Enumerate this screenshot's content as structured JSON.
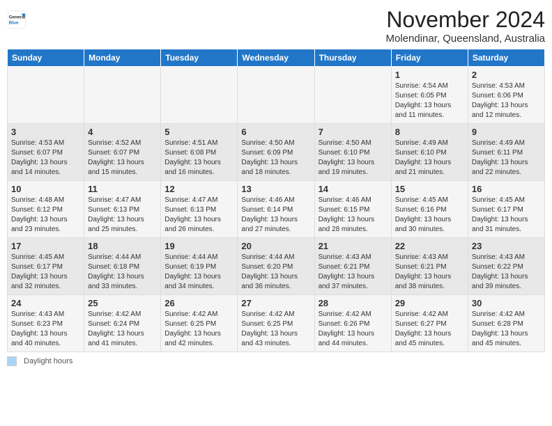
{
  "header": {
    "title": "November 2024",
    "subtitle": "Molendinar, Queensland, Australia"
  },
  "logo": {
    "line1": "General",
    "line2": "Blue"
  },
  "days_of_week": [
    "Sunday",
    "Monday",
    "Tuesday",
    "Wednesday",
    "Thursday",
    "Friday",
    "Saturday"
  ],
  "weeks": [
    [
      {
        "day": "",
        "info": ""
      },
      {
        "day": "",
        "info": ""
      },
      {
        "day": "",
        "info": ""
      },
      {
        "day": "",
        "info": ""
      },
      {
        "day": "",
        "info": ""
      },
      {
        "day": "1",
        "info": "Sunrise: 4:54 AM\nSunset: 6:05 PM\nDaylight: 13 hours and 11 minutes."
      },
      {
        "day": "2",
        "info": "Sunrise: 4:53 AM\nSunset: 6:06 PM\nDaylight: 13 hours and 12 minutes."
      }
    ],
    [
      {
        "day": "3",
        "info": "Sunrise: 4:53 AM\nSunset: 6:07 PM\nDaylight: 13 hours and 14 minutes."
      },
      {
        "day": "4",
        "info": "Sunrise: 4:52 AM\nSunset: 6:07 PM\nDaylight: 13 hours and 15 minutes."
      },
      {
        "day": "5",
        "info": "Sunrise: 4:51 AM\nSunset: 6:08 PM\nDaylight: 13 hours and 16 minutes."
      },
      {
        "day": "6",
        "info": "Sunrise: 4:50 AM\nSunset: 6:09 PM\nDaylight: 13 hours and 18 minutes."
      },
      {
        "day": "7",
        "info": "Sunrise: 4:50 AM\nSunset: 6:10 PM\nDaylight: 13 hours and 19 minutes."
      },
      {
        "day": "8",
        "info": "Sunrise: 4:49 AM\nSunset: 6:10 PM\nDaylight: 13 hours and 21 minutes."
      },
      {
        "day": "9",
        "info": "Sunrise: 4:49 AM\nSunset: 6:11 PM\nDaylight: 13 hours and 22 minutes."
      }
    ],
    [
      {
        "day": "10",
        "info": "Sunrise: 4:48 AM\nSunset: 6:12 PM\nDaylight: 13 hours and 23 minutes."
      },
      {
        "day": "11",
        "info": "Sunrise: 4:47 AM\nSunset: 6:13 PM\nDaylight: 13 hours and 25 minutes."
      },
      {
        "day": "12",
        "info": "Sunrise: 4:47 AM\nSunset: 6:13 PM\nDaylight: 13 hours and 26 minutes."
      },
      {
        "day": "13",
        "info": "Sunrise: 4:46 AM\nSunset: 6:14 PM\nDaylight: 13 hours and 27 minutes."
      },
      {
        "day": "14",
        "info": "Sunrise: 4:46 AM\nSunset: 6:15 PM\nDaylight: 13 hours and 28 minutes."
      },
      {
        "day": "15",
        "info": "Sunrise: 4:45 AM\nSunset: 6:16 PM\nDaylight: 13 hours and 30 minutes."
      },
      {
        "day": "16",
        "info": "Sunrise: 4:45 AM\nSunset: 6:17 PM\nDaylight: 13 hours and 31 minutes."
      }
    ],
    [
      {
        "day": "17",
        "info": "Sunrise: 4:45 AM\nSunset: 6:17 PM\nDaylight: 13 hours and 32 minutes."
      },
      {
        "day": "18",
        "info": "Sunrise: 4:44 AM\nSunset: 6:18 PM\nDaylight: 13 hours and 33 minutes."
      },
      {
        "day": "19",
        "info": "Sunrise: 4:44 AM\nSunset: 6:19 PM\nDaylight: 13 hours and 34 minutes."
      },
      {
        "day": "20",
        "info": "Sunrise: 4:44 AM\nSunset: 6:20 PM\nDaylight: 13 hours and 36 minutes."
      },
      {
        "day": "21",
        "info": "Sunrise: 4:43 AM\nSunset: 6:21 PM\nDaylight: 13 hours and 37 minutes."
      },
      {
        "day": "22",
        "info": "Sunrise: 4:43 AM\nSunset: 6:21 PM\nDaylight: 13 hours and 38 minutes."
      },
      {
        "day": "23",
        "info": "Sunrise: 4:43 AM\nSunset: 6:22 PM\nDaylight: 13 hours and 39 minutes."
      }
    ],
    [
      {
        "day": "24",
        "info": "Sunrise: 4:43 AM\nSunset: 6:23 PM\nDaylight: 13 hours and 40 minutes."
      },
      {
        "day": "25",
        "info": "Sunrise: 4:42 AM\nSunset: 6:24 PM\nDaylight: 13 hours and 41 minutes."
      },
      {
        "day": "26",
        "info": "Sunrise: 4:42 AM\nSunset: 6:25 PM\nDaylight: 13 hours and 42 minutes."
      },
      {
        "day": "27",
        "info": "Sunrise: 4:42 AM\nSunset: 6:25 PM\nDaylight: 13 hours and 43 minutes."
      },
      {
        "day": "28",
        "info": "Sunrise: 4:42 AM\nSunset: 6:26 PM\nDaylight: 13 hours and 44 minutes."
      },
      {
        "day": "29",
        "info": "Sunrise: 4:42 AM\nSunset: 6:27 PM\nDaylight: 13 hours and 45 minutes."
      },
      {
        "day": "30",
        "info": "Sunrise: 4:42 AM\nSunset: 6:28 PM\nDaylight: 13 hours and 45 minutes."
      }
    ]
  ],
  "footer": {
    "legend_label": "Daylight hours"
  }
}
